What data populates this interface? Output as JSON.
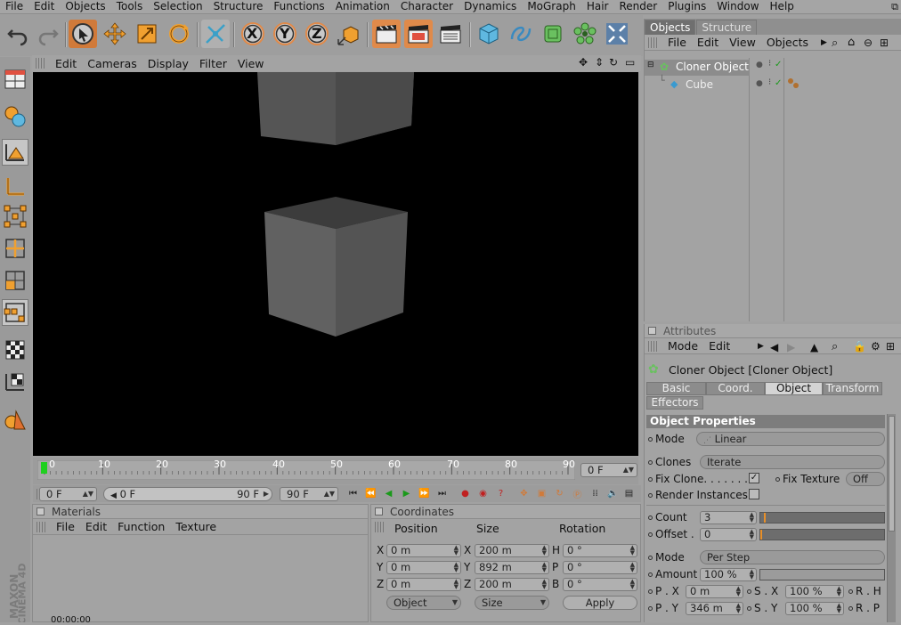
{
  "menubar": {
    "items": [
      "File",
      "Edit",
      "Objects",
      "Tools",
      "Selection",
      "Structure",
      "Functions",
      "Animation",
      "Character",
      "Dynamics",
      "MoGraph",
      "Hair",
      "Render",
      "Plugins",
      "Window",
      "Help"
    ]
  },
  "toolbar": {
    "axis_x": "X",
    "axis_y": "Y",
    "axis_z": "Z"
  },
  "viewport": {
    "menu": [
      "Edit",
      "Cameras",
      "Display",
      "Filter",
      "View"
    ]
  },
  "timeline": {
    "ticks": [
      "0",
      "10",
      "20",
      "30",
      "40",
      "50",
      "60",
      "70",
      "80",
      "90"
    ],
    "current_frame": "0 F",
    "start_field": "0 F",
    "range_left": "0 F",
    "range_right": "90 F",
    "end_field": "90 F"
  },
  "materials": {
    "title": "Materials",
    "menu": [
      "File",
      "Edit",
      "Function",
      "Texture"
    ]
  },
  "coordinates": {
    "title": "Coordinates",
    "col_position": "Position",
    "col_size": "Size",
    "col_rotation": "Rotation",
    "rows": [
      {
        "axis": "X",
        "pos": "0 m",
        "saxis": "X",
        "size": "200 m",
        "raxis": "H",
        "rot": "0 °"
      },
      {
        "axis": "Y",
        "pos": "0 m",
        "saxis": "Y",
        "size": "892 m",
        "raxis": "P",
        "rot": "0 °"
      },
      {
        "axis": "Z",
        "pos": "0 m",
        "saxis": "Z",
        "size": "200 m",
        "raxis": "B",
        "rot": "0 °"
      }
    ],
    "mode_select": "Object",
    "size_select": "Size",
    "apply": "Apply"
  },
  "objects": {
    "tabs": [
      "Objects",
      "Structure"
    ],
    "menu": [
      "File",
      "Edit",
      "View",
      "Objects"
    ],
    "tree": [
      {
        "name": "Cloner Object"
      },
      {
        "name": "Cube"
      }
    ]
  },
  "attributes": {
    "title": "Attributes",
    "menu": [
      "Mode",
      "Edit"
    ],
    "object_title": "Cloner Object [Cloner Object]",
    "tabs": [
      "Basic",
      "Coord.",
      "Object",
      "Transform",
      "Effectors"
    ],
    "section": "Object Properties",
    "mode_label": "Mode",
    "mode_value": "Linear",
    "clones_label": "Clones",
    "clones_value": "Iterate",
    "fix_clone_label": "Fix Clone. . . . . . . .",
    "fix_texture_label": "Fix Texture",
    "fix_texture_value": "Off",
    "render_instances_label": "Render Instances",
    "count_label": "Count",
    "count_value": "3",
    "offset_label": "Offset .",
    "offset_value": "0",
    "mode2_label": "Mode",
    "mode2_value": "Per Step",
    "amount_label": "Amount",
    "amount_value": "100 %",
    "px_label": "P . X",
    "px_value": "0 m",
    "sx_label": "S . X",
    "sx_value": "100 %",
    "rh_label": "R . H",
    "py_label": "P . Y",
    "py_value": "346 m",
    "sy_label": "S . Y",
    "sy_value": "100 %",
    "rp_label": "R . P"
  },
  "logo": {
    "line1": "MAXON",
    "line2": "CINEMA 4D"
  },
  "status": {
    "time": "00:00:00"
  },
  "colors": {
    "accent": "#e08a4a",
    "viewport_bg": "#000000",
    "slider_marker": "#e8902a"
  }
}
